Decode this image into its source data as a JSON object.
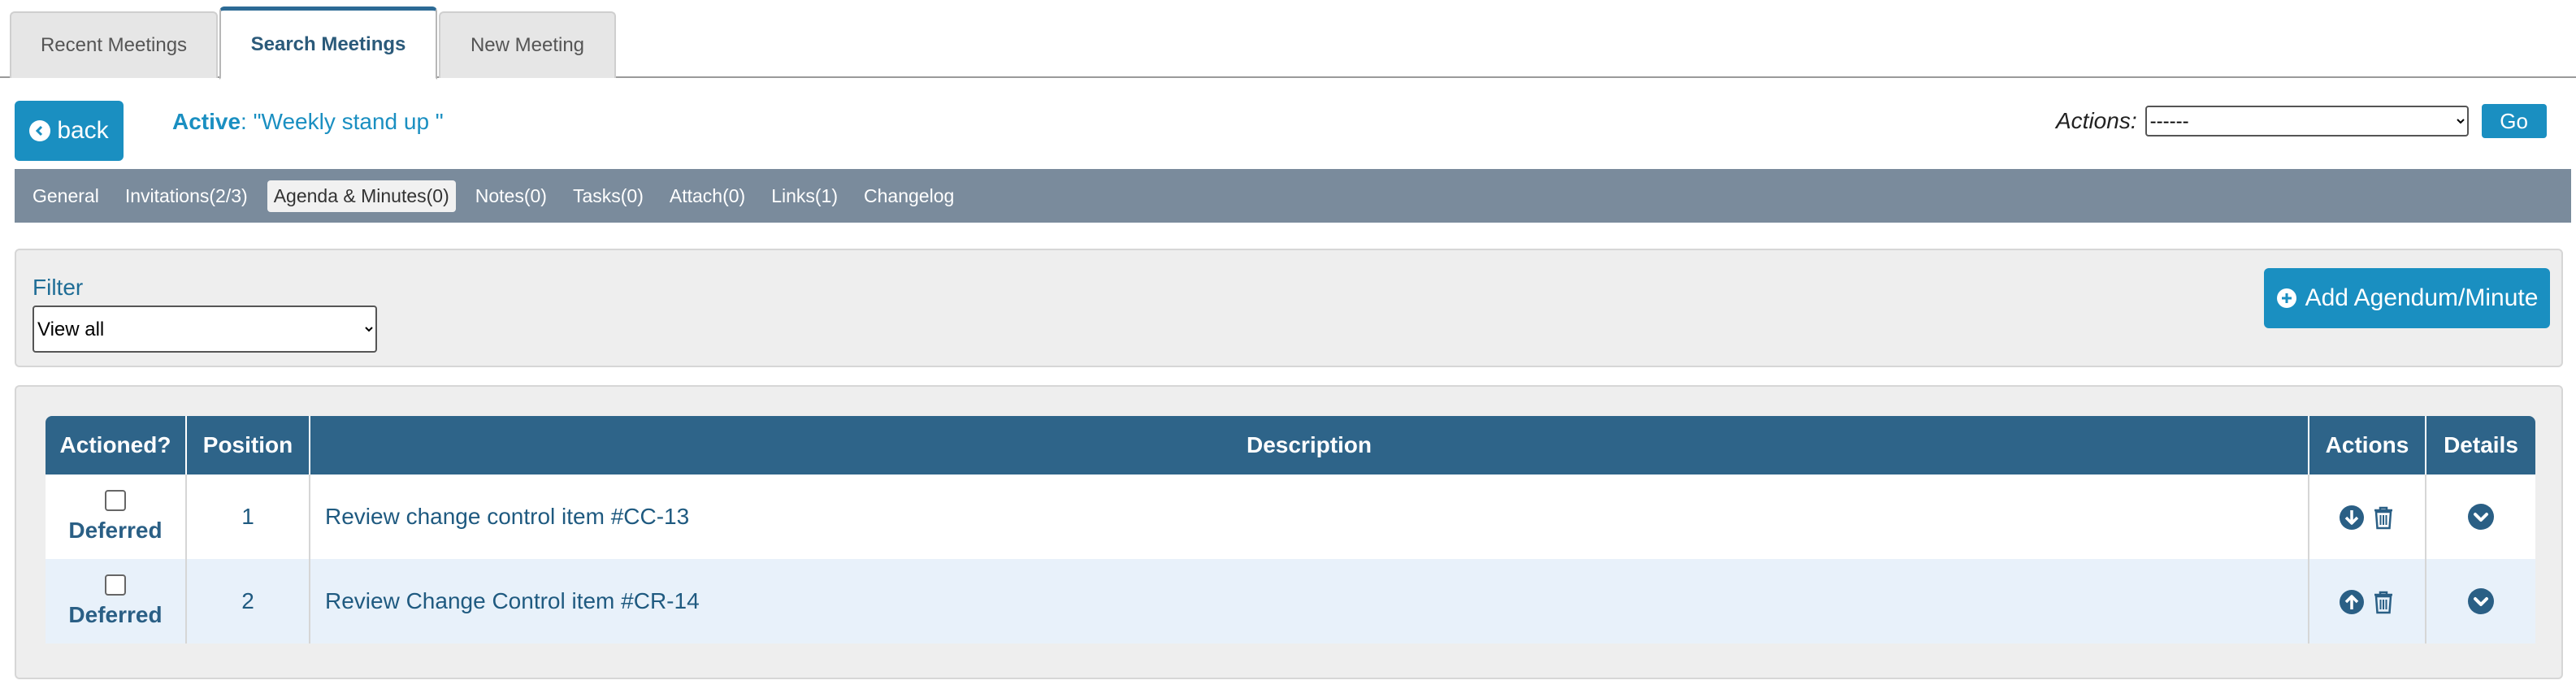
{
  "tabs": [
    {
      "label": "Recent Meetings"
    },
    {
      "label": "Search Meetings"
    },
    {
      "label": "New Meeting"
    }
  ],
  "header": {
    "back_label": "back",
    "active_prefix": "Active",
    "active_value": ": \"Weekly stand up \"",
    "actions_label": "Actions:",
    "actions_selected": "------",
    "go_label": "Go"
  },
  "subnav": [
    {
      "label": "General"
    },
    {
      "label": "Invitations(2/3)"
    },
    {
      "label": "Agenda & Minutes(0)"
    },
    {
      "label": "Notes(0)"
    },
    {
      "label": "Tasks(0)"
    },
    {
      "label": "Attach(0)"
    },
    {
      "label": "Links(1)"
    },
    {
      "label": "Changelog"
    }
  ],
  "filter": {
    "label": "Filter",
    "selected": "View all",
    "add_label": "Add Agendum/Minute"
  },
  "table": {
    "headers": [
      "Actioned?",
      "Position",
      "Description",
      "Actions",
      "Details"
    ],
    "rows": [
      {
        "status": "Deferred",
        "position": "1",
        "description": "Review change control item #CC-13",
        "move_icon": "arrow-down-icon"
      },
      {
        "status": "Deferred",
        "position": "2",
        "description": "Review Change Control item #CR-14",
        "move_icon": "arrow-up-icon"
      }
    ]
  },
  "colors": {
    "primary": "#1a8fc1",
    "table_header": "#2e6489",
    "subnav": "#7a8b9c",
    "row_alt": "#e8f1fa"
  }
}
